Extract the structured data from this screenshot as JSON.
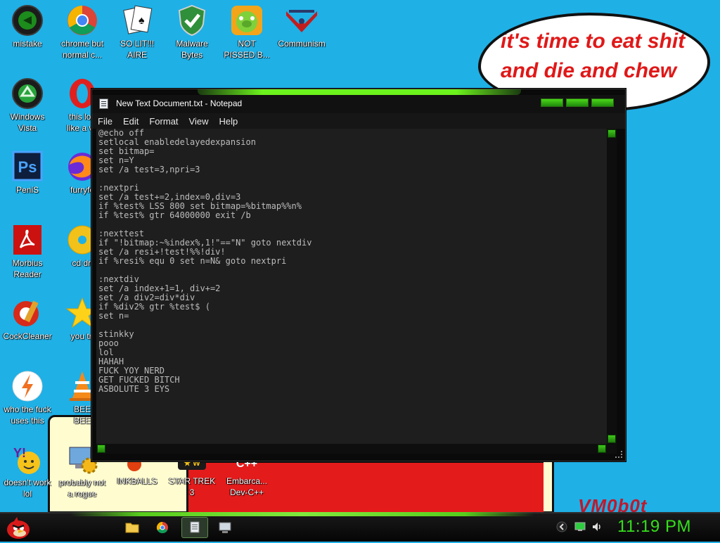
{
  "wallpaper": {
    "bubble_text": "it's time to eat shit and die and chew bubble",
    "signature": "VM0b0t"
  },
  "desktop_icons": [
    {
      "label": "mistake",
      "icon": "green-power-orb-icon"
    },
    {
      "label": "chrome but\nnormal c...",
      "icon": "chrome-icon"
    },
    {
      "label": "SO LIT!!!\nAIRE",
      "icon": "solitaire-cards-icon"
    },
    {
      "label": "Malware\nBytes",
      "icon": "shield-check-icon"
    },
    {
      "label": "NOT\nPISSED B...",
      "icon": "angry-pig-icon"
    },
    {
      "label": "Communism",
      "icon": "red-emblem-icon"
    },
    {
      "label": "Windows\nVista",
      "icon": "recycle-orb-icon"
    },
    {
      "label": "this loo\nlike a va",
      "icon": "opera-icon"
    },
    {
      "label": "PeniS",
      "icon": "photoshop-icon"
    },
    {
      "label": "furryfo",
      "icon": "firefox-icon"
    },
    {
      "label": "Morbius\nReader",
      "icon": "acrobat-icon"
    },
    {
      "label": "cd dri",
      "icon": "cd-drive-icon"
    },
    {
      "label": "CockCleaner",
      "icon": "ccleaner-icon"
    },
    {
      "label": "you tri",
      "icon": "star-icon"
    },
    {
      "label": "who the fuck\nuses this",
      "icon": "lightning-icon"
    },
    {
      "label": "BEE\nBEE",
      "icon": "vlc-cone-icon"
    },
    {
      "label": "doesn't work\nlol",
      "icon": "yahoo-messenger-icon"
    },
    {
      "label": "probably not\na rogue",
      "icon": "gear-computer-icon"
    },
    {
      "label": "INKBALLS",
      "icon": "inkball-icon"
    },
    {
      "label": "STAR TREK\n3",
      "icon": "star-wars-icon"
    },
    {
      "label": "Embarca...\nDev-C++",
      "icon": "cpp-icon"
    }
  ],
  "notepad": {
    "title": "New Text Document.txt - Notepad",
    "menu": [
      "File",
      "Edit",
      "Format",
      "View",
      "Help"
    ],
    "content": "@echo off\nsetlocal enabledelayedexpansion\nset bitmap=\nset n=Y\nset /a test=3,npri=3\n\n:nextpri\nset /a test+=2,index=0,div=3\nif %test% LSS 800 set bitmap=%bitmap%%n%\nif %test% gtr 64000000 exit /b\n\n:nexttest\nif \"!bitmap:~%index%,1!\"==\"N\" goto nextdiv\nset /a resi+!test!%%!div!\nif %resi% equ 0 set n=N& goto nextpri\n\n:nextdiv\nset /a index+1=1, div+=2\nset /a div2=div*div\nif %div2% gtr %test$ (\nset n=\n\nstinkky\npooo\nlol\nHAHAH\nFUCK YOY NERD\nGET FUCKED BITCH\nASBOLUTE 3 EYS"
  },
  "taskbar": {
    "clock": "11:19 PM",
    "pinned": [
      "folder-icon",
      "chrome-icon",
      "notepad-icon",
      "computer-icon"
    ],
    "tray": [
      "chevron-left-icon",
      "network-icon",
      "volume-icon"
    ]
  },
  "colors": {
    "desktop_bg": "#1fb0e6",
    "accent_green": "#6cf21c",
    "clock_green": "#34e01a"
  }
}
